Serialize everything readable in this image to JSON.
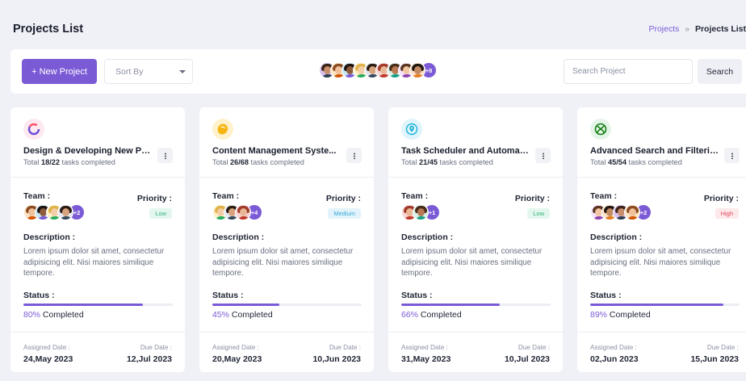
{
  "header": {
    "title": "Projects List",
    "breadcrumb": {
      "link": "Projects",
      "separator": "»",
      "current": "Projects List"
    }
  },
  "toolbar": {
    "new_project_label": "+ New Project",
    "sort_placeholder": "Sort By",
    "avatar_more": "+8",
    "search_placeholder": "Search Project",
    "search_label": "Search"
  },
  "labels": {
    "team": "Team :",
    "priority": "Priority :",
    "description": "Description :",
    "status": "Status :",
    "assigned": "Assigned Date :",
    "due": "Due Date :"
  },
  "projects": [
    {
      "title": "Design & Developing New Pro...",
      "total_prefix": "Total ",
      "tasks_done": "18/22",
      "tasks_suffix": " tasks completed",
      "team_more": "+2",
      "priority": "Low",
      "description": "Lorem ipsum dolor sit amet, consectetur adipisicing elit. Nisi maiores similique tempore.",
      "progress": 0.8,
      "progress_pct": "80%",
      "progress_suffix": " Completed",
      "assigned_date": "24,May 2023",
      "due_date": "12,Jul 2023",
      "icon": "ring-icon"
    },
    {
      "title": "Content Management Syste...",
      "total_prefix": "Total ",
      "tasks_done": "26/68",
      "tasks_suffix": " tasks completed",
      "team_more": "+4",
      "priority": "Medium",
      "description": "Lorem ipsum dolor sit amet, consectetur adipisicing elit. Nisi maiores similique tempore.",
      "progress": 0.45,
      "progress_pct": "45%",
      "progress_suffix": " Completed",
      "assigned_date": "20,May 2023",
      "due_date": "10,Jun 2023",
      "icon": "blob-icon"
    },
    {
      "title": "Task Scheduler and Automati...",
      "total_prefix": "Total ",
      "tasks_done": "21/45",
      "tasks_suffix": " tasks completed",
      "team_more": "+1",
      "priority": "Low",
      "description": "Lorem ipsum dolor sit amet, consectetur adipisicing elit. Nisi maiores similique tempore.",
      "progress": 0.66,
      "progress_pct": "66%",
      "progress_suffix": " Completed",
      "assigned_date": "31,May 2023",
      "due_date": "10,Jul 2023",
      "icon": "location-pin-icon"
    },
    {
      "title": "Advanced Search and Filtering",
      "total_prefix": "Total ",
      "tasks_done": "45/54",
      "tasks_suffix": " tasks completed",
      "team_more": "+2",
      "priority": "High",
      "description": "Lorem ipsum dolor sit amet, consectetur adipisicing elit. Nisi maiores similique tempore.",
      "progress": 0.89,
      "progress_pct": "89%",
      "progress_suffix": " Completed",
      "assigned_date": "02,Jun 2023",
      "due_date": "15,Jun 2023",
      "icon": "xbox-icon"
    }
  ],
  "colors": {
    "accent": "#7b5ad6",
    "low_bg": "#e3f7ee",
    "low_fg": "#2fb07a",
    "medium_bg": "#e2f3fb",
    "medium_fg": "#36a8d6",
    "high_bg": "#fde8ea",
    "high_fg": "#e0485b"
  }
}
